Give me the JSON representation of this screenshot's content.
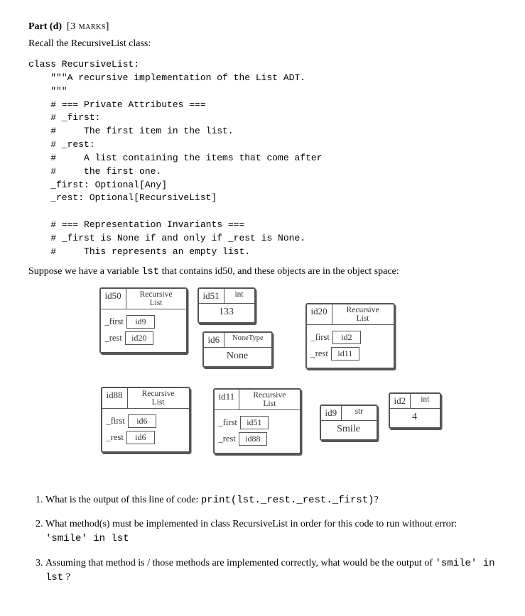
{
  "header": {
    "part": "Part (d)",
    "marks": "[3 marks]"
  },
  "recall": "Recall the RecursiveList class:",
  "code": "class RecursiveList:\n    \"\"\"A recursive implementation of the List ADT.\n    \"\"\"\n    # === Private Attributes ===\n    # _first:\n    #     The first item in the list.\n    # _rest:\n    #     A list containing the items that come after\n    #     the first one.\n    _first: Optional[Any]\n    _rest: Optional[RecursiveList]\n\n    # === Representation Invariants ===\n    # _first is None if and only if _rest is None.\n    #     This represents an empty list.",
  "suppose_pre": "Suppose we have a variable ",
  "suppose_var": "lst",
  "suppose_post": " that contains id50, and these objects are in the object space:",
  "objects": {
    "id50": {
      "id": "id50",
      "type": "Recursive\nList",
      "first": "id9",
      "rest": "id20"
    },
    "id51": {
      "id": "id51",
      "type": "int",
      "value": "133"
    },
    "id6": {
      "id": "id6",
      "type": "NoneType",
      "value": "None"
    },
    "id20": {
      "id": "id20",
      "type": "Recursive\nList",
      "first": "id2",
      "rest": "id11"
    },
    "id88": {
      "id": "id88",
      "type": "Recursive\nList",
      "first": "id6",
      "rest": "id6"
    },
    "id11": {
      "id": "id11",
      "type": "Recursive\nList",
      "first": "id51",
      "rest": "id88"
    },
    "id9": {
      "id": "id9",
      "type": "str",
      "value": "Smile"
    },
    "id2": {
      "id": "id2",
      "type": "int",
      "value": "4"
    }
  },
  "labels": {
    "first": "_first",
    "rest": "_rest"
  },
  "questions": {
    "q1_pre": "What is the output of this line of code: ",
    "q1_code": "print(lst._rest._rest._first)",
    "q1_post": "?",
    "q2_pre": "What method(s) must be implemented in class RecursiveList in order for this code to run without error:   ",
    "q2_code": "'smile' in lst",
    "q3_pre": "Assuming that method is / those methods are implemented correctly, what would be the output of ",
    "q3_code": "'smile' in lst",
    "q3_post": " ?"
  }
}
